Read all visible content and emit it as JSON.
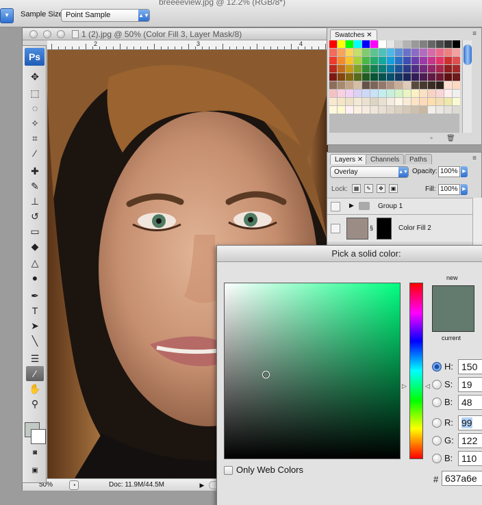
{
  "options_bar": {
    "sample_size_label": "Sample Size:",
    "sample_size_value": "Point Sample",
    "background_doc_title": "breeeeview.jpg @ 12.2% (RGB/8*)"
  },
  "document": {
    "title": "1 (2).jpg @ 50% (Color Fill 3, Layer Mask/8)",
    "ruler_numbers": [
      "2",
      "3",
      "4"
    ],
    "zoom": "50%",
    "doc_size": "Doc: 11.9M/44.5M"
  },
  "toolbox": {
    "logo": "Ps",
    "foreground_color": "#c2c9c5",
    "background_color": "#ffffff",
    "tools": [
      {
        "name": "move",
        "glyph": "✥"
      },
      {
        "name": "marquee",
        "glyph": "⬚"
      },
      {
        "name": "lasso",
        "glyph": "◌"
      },
      {
        "name": "magic-wand",
        "glyph": "✧"
      },
      {
        "name": "crop",
        "glyph": "⌗"
      },
      {
        "name": "slice",
        "glyph": "⁄"
      },
      {
        "name": "healing-brush",
        "glyph": "✚"
      },
      {
        "name": "brush",
        "glyph": "✎"
      },
      {
        "name": "clone-stamp",
        "glyph": "⊥"
      },
      {
        "name": "history-brush",
        "glyph": "↺"
      },
      {
        "name": "eraser",
        "glyph": "▭"
      },
      {
        "name": "paint-bucket",
        "glyph": "◆"
      },
      {
        "name": "blur",
        "glyph": "△"
      },
      {
        "name": "dodge",
        "glyph": "●"
      },
      {
        "name": "pen",
        "glyph": "✒"
      },
      {
        "name": "type",
        "glyph": "T"
      },
      {
        "name": "path-selection",
        "glyph": "➤"
      },
      {
        "name": "line",
        "glyph": "╲"
      },
      {
        "name": "notes",
        "glyph": "☰"
      },
      {
        "name": "eyedropper",
        "glyph": "⁄"
      },
      {
        "name": "hand",
        "glyph": "✋"
      },
      {
        "name": "zoom",
        "glyph": "⚲"
      }
    ],
    "active_tool": "eyedropper"
  },
  "swatches": {
    "tab_label": "Swatches",
    "colors": [
      "#ff0000",
      "#ffff00",
      "#00ff00",
      "#00ffff",
      "#0000ff",
      "#ff00ff",
      "#ffffff",
      "#e6e6e6",
      "#cccccc",
      "#b3b3b3",
      "#999999",
      "#808080",
      "#666666",
      "#4d4d4d",
      "#333333",
      "#000000",
      "#f26b5b",
      "#f7a35c",
      "#fbd55a",
      "#c4df6a",
      "#7fcc6e",
      "#5bc48e",
      "#4fc0b9",
      "#4db8e6",
      "#5b8fd6",
      "#6a72c9",
      "#8c6bc4",
      "#b36bc0",
      "#d86aa8",
      "#ee6a8a",
      "#f08080",
      "#f5a0a0",
      "#ee3b2b",
      "#f48a2a",
      "#f9c22a",
      "#a8d13a",
      "#4cb848",
      "#22ad6f",
      "#13a99f",
      "#14a0dc",
      "#2872c6",
      "#3d4fb3",
      "#6b3eae",
      "#9d3aa8",
      "#c7368b",
      "#e3356a",
      "#d03030",
      "#e05050",
      "#b82a1e",
      "#c26a1a",
      "#c79a18",
      "#80a12a",
      "#348a34",
      "#128052",
      "#0a7d76",
      "#0a77a6",
      "#1c5495",
      "#2c3986",
      "#4e2d82",
      "#742a7d",
      "#942767",
      "#a9264f",
      "#901e1e",
      "#a42a2a",
      "#7a1a12",
      "#82460e",
      "#85670e",
      "#566b1c",
      "#225c22",
      "#0a5536",
      "#06534f",
      "#06506e",
      "#123863",
      "#1d2559",
      "#341d56",
      "#4d1c53",
      "#621a44",
      "#711934",
      "#601010",
      "#6e1a1a",
      "#8c6e5a",
      "#a88a6e",
      "#c2a486",
      "#d6bfa4",
      "#66524a",
      "#7d6658",
      "#94796a",
      "#ae927f",
      "#c9ad98",
      "#e0cab8",
      "#5a4a3e",
      "#48392e",
      "#3a2d24",
      "#2d221b",
      "#ffe0d0",
      "#ffd8c0",
      "#f4c2c2",
      "#f9d0e0",
      "#f3d1f3",
      "#dcd0f5",
      "#cdd8f7",
      "#c8e2f7",
      "#c2eef0",
      "#c7f0dc",
      "#d5f3c7",
      "#ecf5c2",
      "#fbf1c2",
      "#fbe0c2",
      "#f8d2c2",
      "#fad5d5",
      "#ffeeee",
      "#f0f0f0",
      "#f9e7d0",
      "#f5e6c8",
      "#efe1c6",
      "#f3e9d5",
      "#ebe1cf",
      "#ddd4c2",
      "#e9e0d0",
      "#f4ecdf",
      "#fdf5e6",
      "#faebd7",
      "#ffe4c4",
      "#ffdab9",
      "#ffdead",
      "#f5deb3",
      "#eee8aa",
      "#fafad2",
      "#fff8dc",
      "#fffacd",
      "#fff0f5",
      "#fdf0e0",
      "#f7ebe0",
      "#efe6da",
      "#e9dfd2",
      "#e2d8c9",
      "#dbd0bf",
      "#d5c8b6",
      "#cec0ac",
      "#c8b8a2",
      "#f2efe9",
      "#ebe8e2",
      "#e4e1db",
      "#dddad4"
    ]
  },
  "layers": {
    "tabs": [
      "Layers",
      "Channels",
      "Paths"
    ],
    "blend_mode": "Overlay",
    "opacity_label": "Opacity:",
    "opacity": "100%",
    "lock_label": "Lock:",
    "fill_label": "Fill:",
    "fill": "100%",
    "rows": [
      {
        "name": "Group 1"
      },
      {
        "name": "Color Fill 2"
      }
    ]
  },
  "color_picker": {
    "title": "Pick a solid color:",
    "new_label": "new",
    "current_label": "current",
    "new_color": "#637a6e",
    "fields": [
      {
        "label": "H:",
        "value": "150",
        "unit": "°"
      },
      {
        "label": "S:",
        "value": "19",
        "unit": "%"
      },
      {
        "label": "B:",
        "value": "48",
        "unit": "%"
      },
      {
        "label": "R:",
        "value": "99",
        "unit": ""
      },
      {
        "label": "G:",
        "value": "122",
        "unit": ""
      },
      {
        "label": "B:",
        "value": "110",
        "unit": ""
      }
    ],
    "selected_radio": "H",
    "only_web_colors": "Only Web Colors",
    "hash": "#",
    "hex": "637a6e"
  }
}
